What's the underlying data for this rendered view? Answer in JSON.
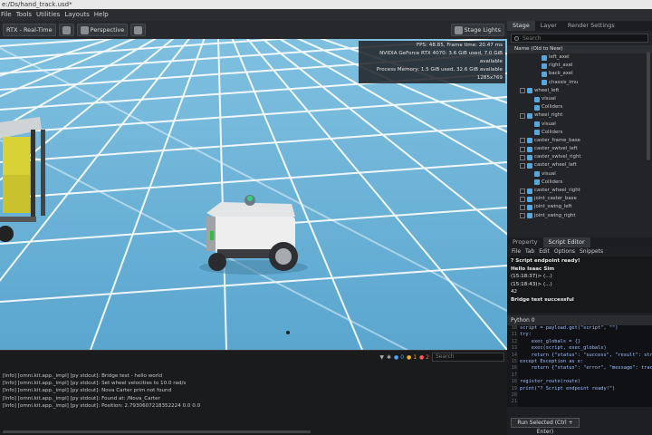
{
  "window": {
    "title": "e:/Ds/hand_track.usd*"
  },
  "menu": [
    "File",
    "Tools",
    "Utilities",
    "Layouts",
    "Help"
  ],
  "toolbar": {
    "render_mode": "RTX - Real-Time",
    "camera": "Perspective",
    "stage_lights": "Stage Lights"
  },
  "stats": [
    "FPS: 48.85, Frame time: 20.47 ms",
    "NVIDIA GeForce RTX 4070: 3.6 GiB used, 7.0 GiB available",
    "Process Memory: 1.5 GiB used, 32.6 GiB available",
    "1285x769"
  ],
  "stage": {
    "tabs": [
      "Stage",
      "Layer",
      "Render Settings"
    ],
    "search_placeholder": "Search",
    "header": "Name (Old to New)",
    "items": [
      "left_axel",
      "right_axel",
      "back_axel",
      "chassis_imu",
      "wheel_left",
      "visual",
      "Colliders",
      "wheel_right",
      "visual",
      "Colliders",
      "caster_frame_base",
      "caster_swivel_left",
      "caster_swivel_right",
      "caster_wheel_left",
      "visual",
      "Colliders",
      "caster_wheel_right",
      "joint_caster_base",
      "joint_swing_left",
      "joint_swing_right"
    ]
  },
  "bottom_tabs": [
    "Property",
    "Script Editor"
  ],
  "script_editor": {
    "menu": [
      "File",
      "Tab",
      "Edit",
      "Options",
      "Snippets"
    ],
    "output": [
      "? Script endpoint ready!",
      "Hello Isaac Sim",
      "(15:18:37)> (...)",
      "(15:18:43)> (...)",
      "42",
      "Bridge test successful"
    ],
    "tab": "Python 0",
    "line_numbers": [
      "10",
      "11",
      "12",
      "13",
      "14",
      "15",
      "16",
      "17",
      "18",
      "19",
      "20",
      "21"
    ],
    "code": [
      "script = payload.get(\"script\", \"\")",
      "try:",
      "    exec_globals = {}",
      "    exec(script, exec_globals)",
      "    return {\"status\": \"success\", \"result\": str(exec_glo",
      "except Exception as e:",
      "    return {\"status\": \"error\", \"message\": traceback.for",
      "",
      "register_route(route)",
      "print(\"? Script endpoint ready!\")"
    ],
    "run_button": "Run Selected (Ctrl + Enter)"
  },
  "console": {
    "counts": [
      "0",
      "1",
      "2"
    ],
    "search_placeholder": "Search",
    "logs": [
      "[Info] [omni.kit.app._impl] [py stdout]: Bridge test - hello world",
      "[Info] [omni.kit.app._impl] [py stdout]: Set wheel velocities to 10.0 rad/s",
      "[Info] [omni.kit.app._impl] [py stdout]: Nova Carter prim not found",
      "[Info] [omni.kit.app._impl] [py stdout]: Found at: /Nova_Carter",
      "[Info] [omni.kit.app._impl] [py stdout]: Position: 2.7930607218352224 0.0 0.0"
    ]
  }
}
